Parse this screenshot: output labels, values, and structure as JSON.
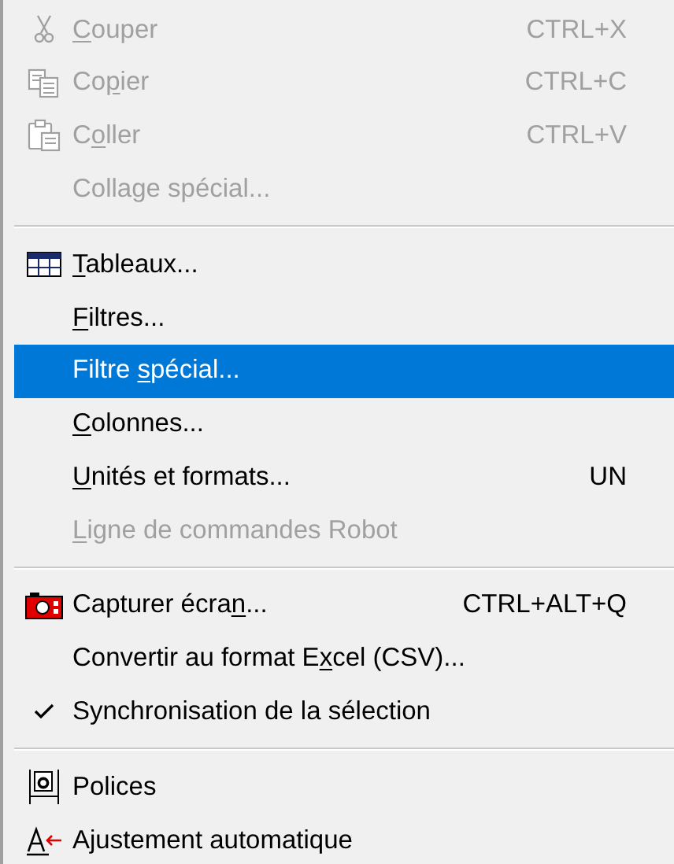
{
  "menu": {
    "groups": [
      {
        "items": [
          {
            "kind": "command",
            "mnemonic": "C",
            "label_after": "ouper",
            "shortcut": "CTRL+X",
            "disabled": true,
            "selected": false
          },
          {
            "kind": "command",
            "label_before": "Co",
            "mnemonic": "p",
            "label_after": "ier",
            "shortcut": "CTRL+C",
            "disabled": true,
            "selected": false
          },
          {
            "kind": "command",
            "label_before": "C",
            "mnemonic": "o",
            "label_after": "ller",
            "shortcut": "CTRL+V",
            "disabled": true,
            "selected": false
          },
          {
            "kind": "command",
            "label_before": "Collage spécial...",
            "disabled": true,
            "selected": false
          }
        ]
      },
      {
        "items": [
          {
            "kind": "command",
            "mnemonic": "T",
            "label_after": "ableaux...",
            "disabled": false,
            "selected": false
          },
          {
            "kind": "command",
            "mnemonic": "F",
            "label_after": "iltres...",
            "disabled": false,
            "selected": false
          },
          {
            "kind": "command",
            "label_before": "Filtre ",
            "mnemonic": "s",
            "label_after": "pécial...",
            "disabled": false,
            "selected": true
          },
          {
            "kind": "command",
            "mnemonic": "C",
            "label_after": "olonnes...",
            "disabled": false,
            "selected": false
          },
          {
            "kind": "command",
            "mnemonic": "U",
            "label_after": "nités et formats...",
            "shortcut": "UN",
            "disabled": false,
            "selected": false
          },
          {
            "kind": "command",
            "mnemonic": "L",
            "label_after": "igne de commandes Robot",
            "disabled": true,
            "selected": false
          }
        ]
      },
      {
        "items": [
          {
            "kind": "command",
            "label_before": "Capturer écra",
            "mnemonic": "n",
            "label_after": "...",
            "shortcut": "CTRL+ALT+Q",
            "disabled": false,
            "selected": false
          },
          {
            "kind": "command",
            "label_before": "Convertir au format E",
            "mnemonic": "x",
            "label_after": "cel (CSV)...",
            "disabled": false,
            "selected": false
          },
          {
            "kind": "check",
            "label_before": "Synchronisation de la sélection",
            "disabled": false,
            "selected": false,
            "checked": true
          }
        ]
      },
      {
        "items": [
          {
            "kind": "command",
            "label_before": "Polices",
            "disabled": false,
            "selected": false
          },
          {
            "kind": "command",
            "label_before": "Ajustement automatique",
            "disabled": false,
            "selected": false
          }
        ]
      }
    ]
  }
}
